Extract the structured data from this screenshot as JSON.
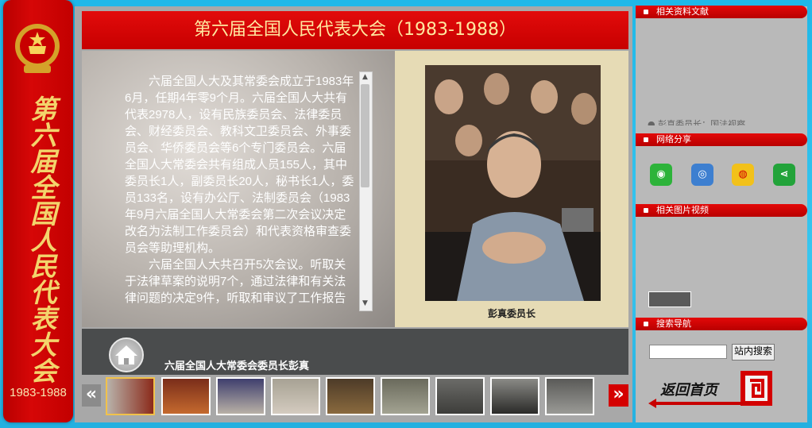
{
  "left_banner": {
    "title_vertical": "第六届全国人民代表大会",
    "years": "1983-1988"
  },
  "main": {
    "title": "第六届全国人民代表大会（1983-1988）",
    "article": [
      "六届全国人大及其常委会成立于1983年6月，任期4年零9个月。六届全国人大共有代表2978人，设有民族委员会、法律委员会、财经委员会、教科文卫委员会、外事委员会、华侨委员会等6个专门委员会。六届全国人大常委会共有组成人员155人，其中委员长1人，副委员长20人，秘书长1人，委员133名，设有办公厅、法制委员会（1983年9月六届全国人大常委会第二次会议决定改名为法制工作委员会）和代表资格审查委员会等助理机构。",
      "六届全国人大共召开5次会议。听取关于法律草案的说明7个，通过法律和有关法律问题的决定9件，听取和审议了工作报告"
    ],
    "photo_caption": "彭真委员长",
    "sub_caption": "六届全国人大常委会委员长彭真"
  },
  "right": {
    "sections": {
      "related_docs": "相关资料文献",
      "share": "网络分享",
      "media": "相关图片视频",
      "search_nav": "搜索导航"
    },
    "related_text": "● 彭真委员长：国法视察",
    "share_icons": [
      "wechat-icon",
      "tencent-icon",
      "weibo-icon",
      "share-icon"
    ],
    "search": {
      "input_value": "",
      "button_label": "站内搜索"
    },
    "back_home": "返回首页"
  },
  "colors": {
    "accent_red": "#d60707",
    "title_gold": "#ffe9a0",
    "background": "#2ab9e8"
  }
}
